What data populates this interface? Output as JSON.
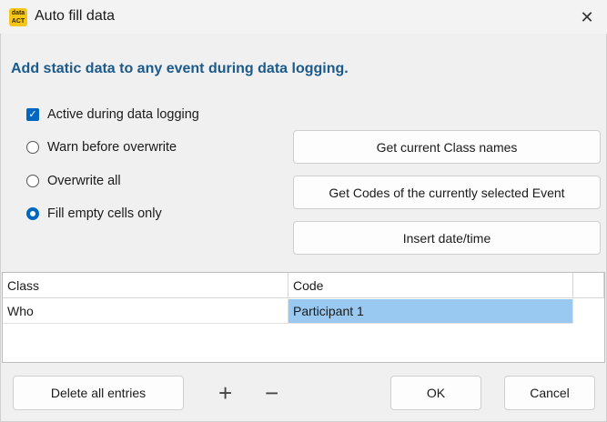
{
  "window": {
    "title": "Auto fill data",
    "app_icon_text": "data\nACT",
    "close_glyph": "✕"
  },
  "heading": "Add static data to any event during data logging.",
  "options": {
    "active": {
      "label": "Active during data logging",
      "checked": true
    },
    "radios": [
      {
        "label": "Warn before overwrite",
        "selected": false
      },
      {
        "label": "Overwrite all",
        "selected": false
      },
      {
        "label": "Fill empty cells only",
        "selected": true
      }
    ]
  },
  "buttons": {
    "get_class_names": "Get current Class names",
    "get_codes": "Get Codes of the currently selected Event",
    "insert_datetime": "Insert date/time",
    "delete_all": "Delete all entries",
    "plus": "+",
    "minus": "−",
    "ok": "OK",
    "cancel": "Cancel"
  },
  "table": {
    "columns": [
      "Class",
      "Code"
    ],
    "rows": [
      {
        "class": "Who",
        "code": "Participant 1"
      }
    ]
  },
  "colors": {
    "accent": "#0067c0",
    "heading": "#1b5a8a",
    "selection": "#99c9f0",
    "app_icon": "#f5c518"
  }
}
